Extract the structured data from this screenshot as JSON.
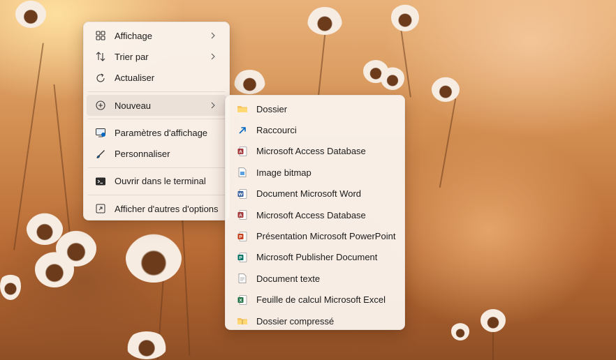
{
  "context_menu": {
    "items": [
      {
        "label": "Affichage",
        "icon": "grid-view-icon"
      },
      {
        "label": "Trier par",
        "icon": "sort-arrows-icon"
      },
      {
        "label": "Actualiser",
        "icon": "refresh-icon"
      },
      {
        "label": "Nouveau",
        "icon": "add-circle-icon"
      },
      {
        "label": "Paramètres d'affichage",
        "icon": "display-settings-icon"
      },
      {
        "label": "Personnaliser",
        "icon": "brush-icon"
      },
      {
        "label": "Ouvrir dans le terminal",
        "icon": "terminal-icon"
      },
      {
        "label": "Afficher d'autres d'options",
        "icon": "more-options-icon"
      }
    ]
  },
  "submenu_new": {
    "items": [
      {
        "label": "Dossier",
        "icon": "folder-icon"
      },
      {
        "label": "Raccourci",
        "icon": "shortcut-icon"
      },
      {
        "label": "Microsoft Access Database",
        "icon": "access-icon"
      },
      {
        "label": "Image bitmap",
        "icon": "bitmap-icon"
      },
      {
        "label": "Document Microsoft Word",
        "icon": "word-icon"
      },
      {
        "label": "Microsoft Access Database",
        "icon": "access-icon"
      },
      {
        "label": "Présentation Microsoft PowerPoint",
        "icon": "powerpoint-icon"
      },
      {
        "label": "Microsoft Publisher Document",
        "icon": "publisher-icon"
      },
      {
        "label": "Document texte",
        "icon": "text-document-icon"
      },
      {
        "label": "Feuille de calcul Microsoft Excel",
        "icon": "excel-icon"
      },
      {
        "label": "Dossier compressé",
        "icon": "zip-folder-icon"
      }
    ]
  },
  "colors": {
    "access": "#a4373a",
    "word": "#2b579a",
    "powerpoint": "#c43e1c",
    "publisher": "#077568",
    "excel": "#217346",
    "folder": "#f4c15c",
    "accent": "#0067c0"
  }
}
